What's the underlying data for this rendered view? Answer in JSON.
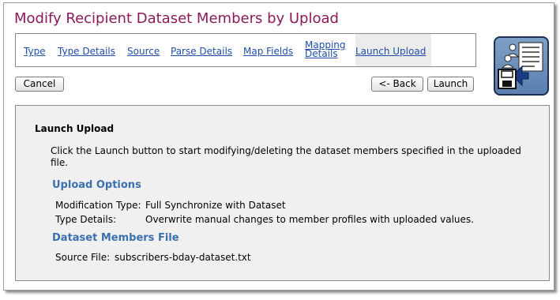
{
  "page": {
    "title": "Modify Recipient Dataset Members by Upload"
  },
  "tabs": [
    {
      "label": "Type"
    },
    {
      "label": "Type Details"
    },
    {
      "label": "Source"
    },
    {
      "label": "Parse Details"
    },
    {
      "label": "Map Fields"
    },
    {
      "label_line1": "Mapping",
      "label_line2": "Details"
    },
    {
      "label": "Launch Upload",
      "active": true
    }
  ],
  "toolbar": {
    "cancel_label": "Cancel",
    "back_label": "<- Back",
    "launch_label": "Launch"
  },
  "panel": {
    "heading": "Launch Upload",
    "intro": "Click the Launch button to start modifying/deleting the dataset members specified in the uploaded file.",
    "upload_options": {
      "title": "Upload Options",
      "modification_type_label": "Modification Type:",
      "modification_type_value": "Full Synchronize with Dataset",
      "type_details_label": "Type Details:",
      "type_details_value": "Overwrite manual changes to member profiles with uploaded values."
    },
    "members_file": {
      "title": "Dataset Members File",
      "source_file_label": "Source File:",
      "source_file_value": "subscribers-bday-dataset.txt"
    }
  },
  "icons": {
    "wizard": "dataset-upload-save-icon"
  },
  "colors": {
    "title": "#8b1a5a",
    "link": "#1f4fa8",
    "section": "#3a6fb0",
    "panel_bg": "#f0f0f0"
  }
}
